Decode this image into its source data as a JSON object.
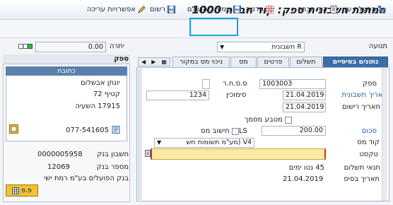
{
  "window": {
    "title": "המתנת חשבונית ספק: קוד חברה 1000"
  },
  "toolbar": {
    "items": [
      {
        "label": "הפעלת עץ"
      },
      {
        "label": "קוד חברה"
      },
      {
        "label": "הדמה"
      },
      {
        "label": "שמור כ'הושלם"
      },
      {
        "label": "רשום"
      },
      {
        "label": "אפשרויות עריכה"
      }
    ]
  },
  "header": {
    "transaction_label": "תנועה",
    "transaction_value": "R חשבונית",
    "balance_label": "יתרה",
    "balance_value": "0.00"
  },
  "tabs": [
    {
      "label": "נתונים בסיסיים"
    },
    {
      "label": "תשלום"
    },
    {
      "label": "פרטים"
    },
    {
      "label": "מס"
    },
    {
      "label": "ניכוי מס במקור"
    }
  ],
  "basic": {
    "vendor_label": "ספק",
    "vendor_value": "1003003",
    "sbr_label": "ס.ס.ח.ר",
    "invoice_date_label": "תאריך חשבונית",
    "invoice_date_value": "21.04.2019",
    "reference_label": "סימוכין",
    "reference_value": "1234",
    "posting_date_label": "תאריך רישום",
    "posting_date_value": "21.04.2019",
    "doc_currency_label": "מטבע מסמך",
    "amount_label": "סכום",
    "amount_value": "200.00",
    "currency_value": "ILS",
    "calc_tax_label": "חישוב מס",
    "tax_code_label": "קוד מס",
    "tax_code_value": "V4 (מע\"מ תשומות חש",
    "text_label": "טקסט",
    "text_value": "",
    "payment_terms_label": "תנאי תשלום",
    "payment_terms_value": "45 נטו ימים",
    "baseline_date_label": "תאריך בסיס",
    "baseline_date_value": "21.04.2019"
  },
  "side": {
    "title": "ספק",
    "address_title": "כתובת",
    "address_lines": [
      "יונתן אבשלום",
      "קטיף 72",
      "17915 השעיה"
    ],
    "phone": "077-541605",
    "bank_account_label": "חשבון בנק",
    "bank_account_value": "0000005958",
    "bank_number_label": "מספר בנק",
    "bank_number_value": "12069",
    "bank_name": "בנק הפועלים בע\"מ רמת ישי",
    "button_label": "פ.פ"
  },
  "colors": {
    "accent": "#3b6da6",
    "highlight": "#19a3e0",
    "text_field_yellow": "#fbe9a6",
    "label_blue": "#1b5fa8"
  }
}
